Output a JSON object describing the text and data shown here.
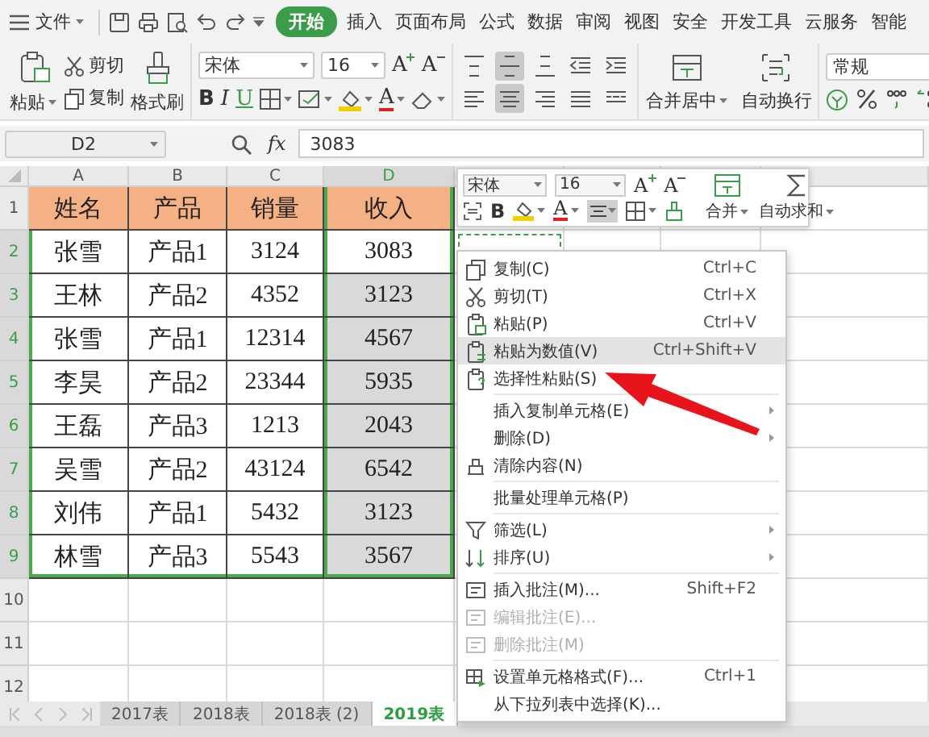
{
  "menu": {
    "file": "文件",
    "tabs": [
      {
        "label": "开始",
        "selected": true
      },
      {
        "label": "插入",
        "selected": false
      },
      {
        "label": "页面布局",
        "selected": false
      },
      {
        "label": "公式",
        "selected": false
      },
      {
        "label": "数据",
        "selected": false
      },
      {
        "label": "审阅",
        "selected": false
      },
      {
        "label": "视图",
        "selected": false
      },
      {
        "label": "安全",
        "selected": false
      },
      {
        "label": "开发工具",
        "selected": false
      },
      {
        "label": "云服务",
        "selected": false
      },
      {
        "label": "智能",
        "selected": false
      }
    ]
  },
  "ribbon": {
    "paste": "粘贴",
    "cut": "剪切",
    "copy": "复制",
    "format_painter": "格式刷",
    "font": "宋体",
    "font_size": "16",
    "grow_font": "A",
    "shrink_font": "A",
    "bold": "B",
    "italic": "I",
    "underline": "U",
    "font_color": "A",
    "align_buttons": [
      {
        "kind": "top",
        "selected": false
      },
      {
        "kind": "middle",
        "selected": true
      },
      {
        "kind": "bottom",
        "selected": false
      },
      {
        "kind": "outdent",
        "selected": false
      },
      {
        "kind": "indent",
        "selected": false
      },
      {
        "kind": "left",
        "selected": false
      },
      {
        "kind": "center",
        "selected": true
      },
      {
        "kind": "right",
        "selected": false
      },
      {
        "kind": "justify",
        "selected": false
      },
      {
        "kind": "distribute",
        "selected": false
      }
    ],
    "merge": "合并居中",
    "wrap": "自动换行",
    "number_format": "常规"
  },
  "formula_bar": {
    "cell": "D2",
    "fx": "fx",
    "value": "3083"
  },
  "sheet": {
    "columns": [
      {
        "label": "A",
        "selected": false
      },
      {
        "label": "B",
        "selected": false
      },
      {
        "label": "C",
        "selected": false
      },
      {
        "label": "D",
        "selected": true
      }
    ],
    "rows": [
      {
        "label": "1",
        "kind": "header",
        "selected": false,
        "active": false,
        "cells": [
          "姓名",
          "产品",
          "销量",
          "收入"
        ]
      },
      {
        "label": "2",
        "kind": "data",
        "selected": true,
        "active": true,
        "cells": [
          "张雪",
          "产品1",
          "3124",
          "3083"
        ]
      },
      {
        "label": "3",
        "kind": "data",
        "selected": true,
        "active": false,
        "cells": [
          "王林",
          "产品2",
          "4352",
          "3123"
        ]
      },
      {
        "label": "4",
        "kind": "data",
        "selected": true,
        "active": false,
        "cells": [
          "张雪",
          "产品1",
          "12314",
          "4567"
        ]
      },
      {
        "label": "5",
        "kind": "data",
        "selected": true,
        "active": false,
        "cells": [
          "李昊",
          "产品2",
          "23344",
          "5935"
        ]
      },
      {
        "label": "6",
        "kind": "data",
        "selected": true,
        "active": false,
        "cells": [
          "王磊",
          "产品3",
          "1213",
          "2043"
        ]
      },
      {
        "label": "7",
        "kind": "data",
        "selected": true,
        "active": false,
        "cells": [
          "吴雪",
          "产品2",
          "43124",
          "6542"
        ]
      },
      {
        "label": "8",
        "kind": "data",
        "selected": true,
        "active": false,
        "cells": [
          "刘伟",
          "产品1",
          "5432",
          "3123"
        ]
      },
      {
        "label": "9",
        "kind": "data",
        "selected": true,
        "active": false,
        "cells": [
          "林雪",
          "产品3",
          "5543",
          "3567"
        ]
      }
    ],
    "empty_rows": [
      "10",
      "11",
      "12"
    ],
    "copy_marquee": true
  },
  "sheet_tabs": [
    {
      "label": "2017表",
      "selected": false
    },
    {
      "label": "2018表",
      "selected": false
    },
    {
      "label": "2018表 (2)",
      "selected": false
    },
    {
      "label": "2019表",
      "selected": true
    }
  ],
  "mini_toolbar": {
    "font": "宋体",
    "font_size": "16",
    "grow_font": "A",
    "shrink_font": "A",
    "bold": "B",
    "font_color": "A",
    "align_button": {
      "selected": true
    },
    "merge": "合并",
    "autosum": "自动求和"
  },
  "context_menu": {
    "items": [
      {
        "kind": "item",
        "label": "复制(C)",
        "shortcut": "Ctrl+C",
        "disabled": false,
        "selected": false,
        "submenu": false
      },
      {
        "kind": "item",
        "label": "剪切(T)",
        "shortcut": "Ctrl+X",
        "disabled": false,
        "selected": false,
        "submenu": false
      },
      {
        "kind": "item",
        "label": "粘贴(P)",
        "shortcut": "Ctrl+V",
        "disabled": false,
        "selected": false,
        "submenu": false
      },
      {
        "kind": "item",
        "label": "粘贴为数值(V)",
        "shortcut": "Ctrl+Shift+V",
        "disabled": false,
        "selected": true,
        "submenu": false
      },
      {
        "kind": "item",
        "label": "选择性粘贴(S)",
        "disabled": false,
        "selected": false,
        "submenu": false
      },
      {
        "kind": "separator"
      },
      {
        "kind": "item",
        "label": "插入复制单元格(E)",
        "disabled": false,
        "selected": false,
        "submenu": true
      },
      {
        "kind": "item",
        "label": "删除(D)",
        "disabled": false,
        "selected": false,
        "submenu": true
      },
      {
        "kind": "item",
        "label": "清除内容(N)",
        "disabled": false,
        "selected": false,
        "submenu": false
      },
      {
        "kind": "separator"
      },
      {
        "kind": "item",
        "label": "批量处理单元格(P)",
        "disabled": false,
        "selected": false,
        "submenu": false
      },
      {
        "kind": "separator"
      },
      {
        "kind": "item",
        "label": "筛选(L)",
        "disabled": false,
        "selected": false,
        "submenu": true
      },
      {
        "kind": "item",
        "label": "排序(U)",
        "disabled": false,
        "selected": false,
        "submenu": true
      },
      {
        "kind": "separator"
      },
      {
        "kind": "item",
        "label": "插入批注(M)...",
        "shortcut": "Shift+F2",
        "disabled": false,
        "selected": false,
        "submenu": false
      },
      {
        "kind": "item",
        "label": "编辑批注(E)...",
        "disabled": true,
        "selected": false,
        "submenu": false
      },
      {
        "kind": "item",
        "label": "删除批注(M)",
        "disabled": true,
        "selected": false,
        "submenu": false
      },
      {
        "kind": "separator"
      },
      {
        "kind": "item",
        "label": "设置单元格格式(F)...",
        "shortcut": "Ctrl+1",
        "disabled": false,
        "selected": false,
        "submenu": false
      },
      {
        "kind": "item",
        "label": "从下拉列表中选择(K)...",
        "disabled": false,
        "selected": false,
        "submenu": false
      }
    ]
  }
}
